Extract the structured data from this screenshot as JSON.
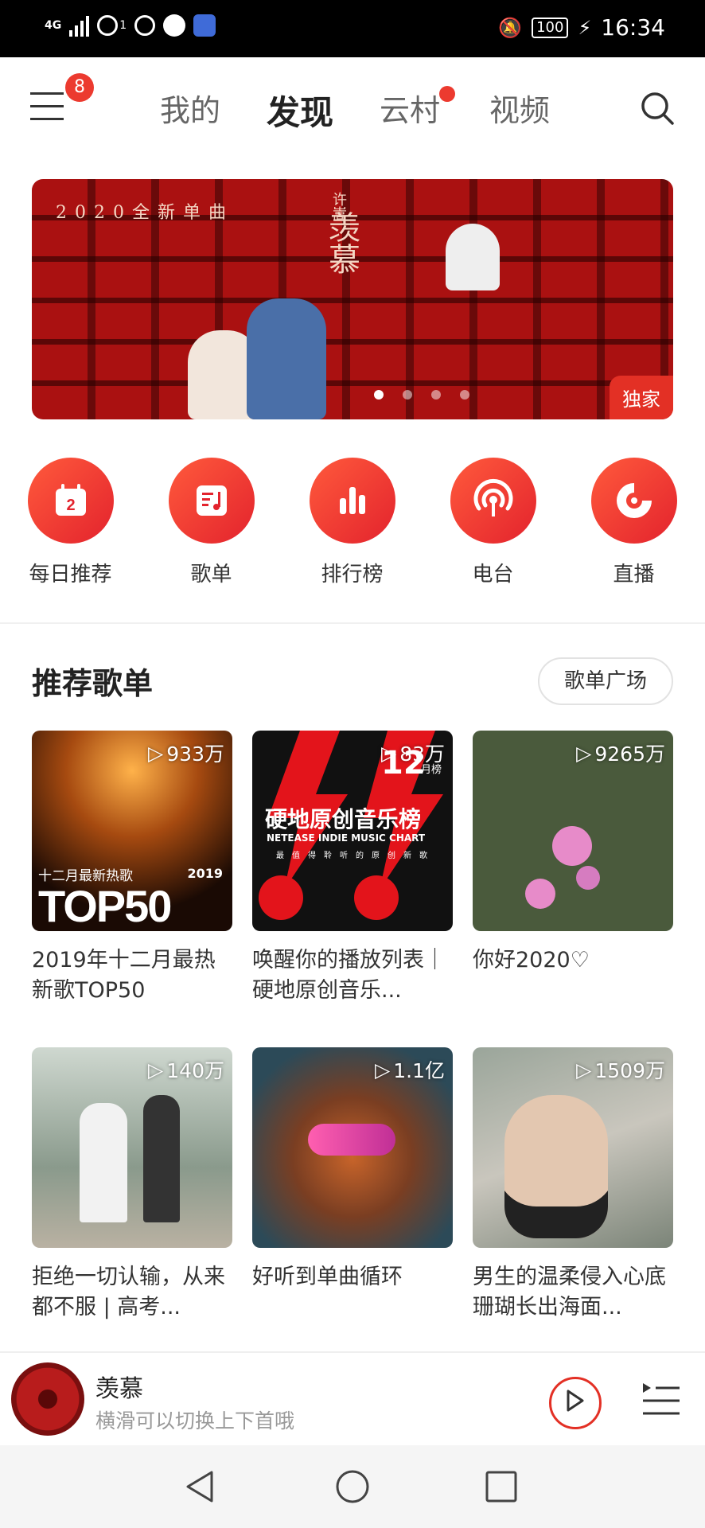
{
  "status_bar": {
    "network": "4G",
    "hotspot_count": "1",
    "battery": "100",
    "time": "16:34"
  },
  "nav": {
    "badge_count": "8",
    "tabs": [
      {
        "label": "我的"
      },
      {
        "label": "发现"
      },
      {
        "label": "云村"
      },
      {
        "label": "视频"
      }
    ],
    "active_tab": "发现"
  },
  "banner": {
    "top_text": "2020全新单曲",
    "artist": "许嵩",
    "song": "羡慕",
    "tag": "独家"
  },
  "quick_entries": [
    {
      "label": "每日推荐",
      "icon": "calendar-icon",
      "day": "2"
    },
    {
      "label": "歌单",
      "icon": "playlist-icon"
    },
    {
      "label": "排行榜",
      "icon": "chart-bars-icon"
    },
    {
      "label": "电台",
      "icon": "radio-icon"
    },
    {
      "label": "直播",
      "icon": "live-icon"
    }
  ],
  "section": {
    "title": "推荐歌单",
    "plaza_button": "歌单广场"
  },
  "playlists": [
    {
      "plays": "933万",
      "title": "2019年十二月最热新歌TOP50",
      "cover_text_top": "十二月最新热歌",
      "cover_year": "2019",
      "cover_big": "TOP50"
    },
    {
      "plays": "83万",
      "title": "唤醒你的播放列表｜硬地原创音乐...",
      "cover_month": "12",
      "cover_month_unit": "月榜",
      "cover_title": "硬地原创音乐榜",
      "cover_sub": "NETEASE INDIE MUSIC CHART",
      "cover_small": "最值得聆听的原创新歌"
    },
    {
      "plays": "9265万",
      "title": "你好2020♡"
    },
    {
      "plays": "140万",
      "title": "拒绝一切认输，从来都不服 | 高考..."
    },
    {
      "plays": "1.1亿",
      "title": "好听到单曲循环"
    },
    {
      "plays": "1509万",
      "title": "男生的温柔侵入心底 珊瑚长出海面..."
    }
  ],
  "player": {
    "song": "羡慕",
    "hint": "横滑可以切换上下首哦"
  },
  "colors": {
    "accent": "#e33025",
    "badge": "#ec3a2f"
  }
}
